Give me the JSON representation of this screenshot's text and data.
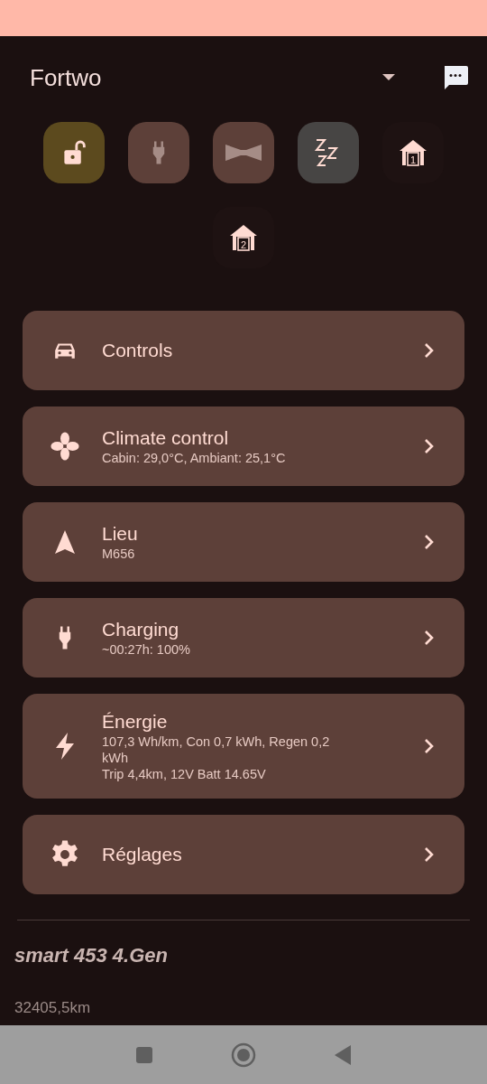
{
  "header": {
    "title": "Fortwo"
  },
  "quick_actions": [
    {
      "kind": "lock",
      "color": "#5c4a1e",
      "disabled": false
    },
    {
      "kind": "plug",
      "color": "#5d4039",
      "disabled": true
    },
    {
      "kind": "bowtie",
      "color": "#5d4039",
      "disabled": true
    },
    {
      "kind": "sleep",
      "color": "#474544",
      "disabled": false
    },
    {
      "kind": "garage",
      "color": "#1e1212",
      "disabled": false,
      "label": "1"
    },
    {
      "kind": "garage",
      "color": "#1e1212",
      "disabled": false,
      "label": "2"
    }
  ],
  "menu": [
    {
      "kind": "car",
      "title": "Controls"
    },
    {
      "kind": "fan",
      "title": "Climate control",
      "lines": [
        "Cabin: 29,0°C, Ambiant: 25,1°C"
      ]
    },
    {
      "kind": "navigation",
      "title": "Lieu",
      "lines": [
        "M656"
      ]
    },
    {
      "kind": "plug",
      "title": "Charging",
      "lines": [
        "~00:27h: 100%"
      ]
    },
    {
      "kind": "bolt",
      "title": "Énergie",
      "lines": [
        "107,3 Wh/km, Con 0,7 kWh, Regen 0,2 kWh",
        "Trip 4,4km, 12V Batt 14.65V"
      ]
    },
    {
      "kind": "gear",
      "title": "Réglages"
    }
  ],
  "vehicle": {
    "model": "smart 453 4.Gen",
    "odometer": "32405,5km"
  }
}
